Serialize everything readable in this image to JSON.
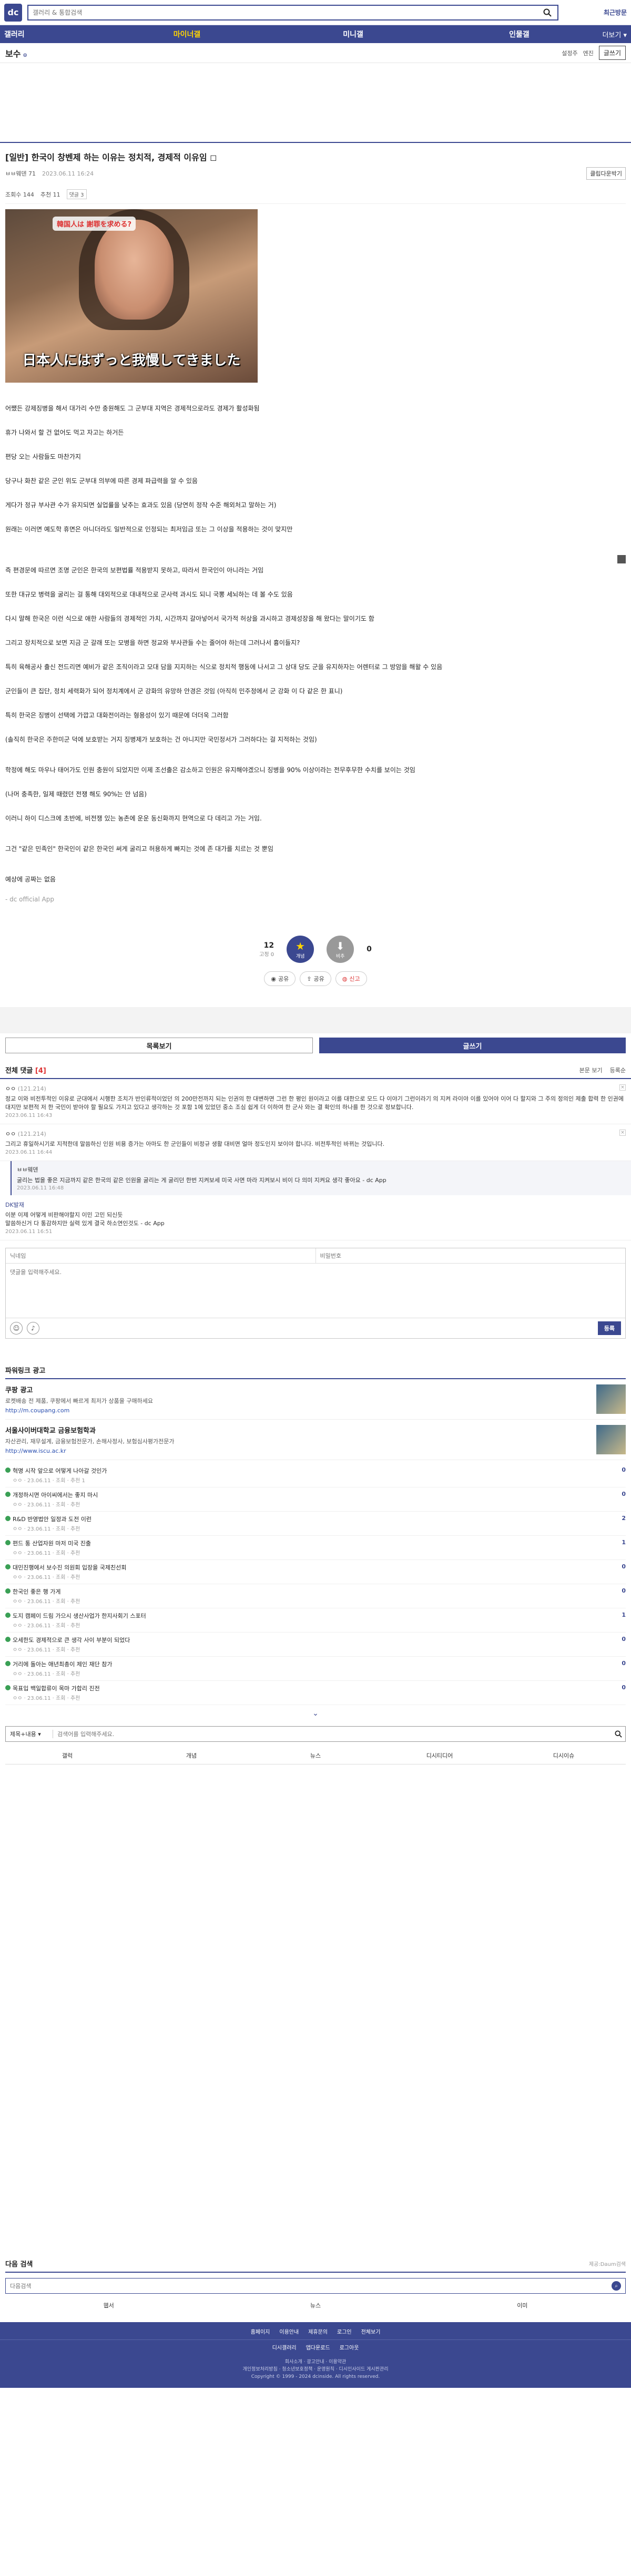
{
  "header": {
    "logo": "dc",
    "search_placeholder": "갤러리 & 통합검색",
    "recent_label": "최근방문"
  },
  "gnb": {
    "items": [
      {
        "label": "갤러리",
        "active": false
      },
      {
        "label": "마이너갤",
        "active": true
      },
      {
        "label": "미니갤",
        "active": false
      },
      {
        "label": "인물갤",
        "active": false
      }
    ],
    "more_label": "더보기 ▾"
  },
  "gallery": {
    "title": "보수",
    "tools": [
      "설정주",
      "엔진"
    ],
    "write_box": "글쓰기"
  },
  "post": {
    "title": "[일반] 한국이 창벤제 하는 이유는 정치적, 경제적 이유임 ◻",
    "author": "ㅂㅂ웨덴 71",
    "date": "2023.06.11 16:24",
    "clip_label": "클립다운박기",
    "views": "조회수 144",
    "recommend": "추천 11",
    "comments": "댓글 3",
    "image_caption_top": "韓国人は\n謝罪を求める?",
    "image_caption": "日本人にはずっと我慢してきました",
    "paragraphs_a": [
      "어쨌든 강제징병을 해서 대가리 수만 충원해도 그 군부대 지역은 경제적으로라도 경제가 활성화됨",
      "휴가 나와서 할 건 없어도 먹고 자고는 하거든",
      "편당 오는 사람들도 마찬가지",
      "당구나 화찬 같은 군인 위도 군부대 의부에 따른 경제 파급력을 알 수 있음",
      "게다가 정규 부사관 수가 유지되면 실업률을 낮추는 효과도 있음 (당연히 정작 수준 해외처고 말하는 거)",
      "원래는 이러면 예도학 휴면은 아니더라도 일반적으로 인정되는 최저임금 또는 그 이상을 적용하는 것이 맞지만"
    ],
    "paragraphs_b": [
      "즉 편경문에 따르면 조명 군인은 한국의 보편법률 적용받지 못하고, 따라서 한국인이 아니라는 거임",
      "또한 대규모 병력을 굴리는 걸 통해 대외적으로 대내적으로 군사력 과시도 되니 국뽕 세뇌하는 데 볼 수도 있음",
      "다시 말해 한국은 이런 식으로 애한 사람들의 경제적인 가치, 시간까지 갈아넣어서 국가적 허상을 과시하고 경제성장을 해 왔다는 말이기도 함",
      "그리고 장치적으로 보면 지금 군 갈래 또는 모병을 하면 정교와 부사관들 수는 줄어야 하는데 그러나서 흉이들지?",
      "특히 육해공사 출신 전드리면 예비가 같은 조직이라고 모대 담을 지지하는 식으로 정치적 행동에 나서고 그 상대 당도 군을 유지하자는 어렌터로 그 방암을 해왈 수 있음",
      "군인들이 큰 집단, 정치 세력화가 되어 정치계에서 군 강화의 유망하 안경은 것임 (아직히 민주정에서 군 강화 이 다 같은 한 표니)",
      "특히 한국은 징병이 선택에 가깝고 대화전이라는 형용성이 있기 때문에 더더욱 그러함",
      "(솔직히 한국은 주한미군 덕에 보호받는 거지 징병제가 보호하는 건 아니지만 국민정서가 그러하다는 걸 지적하는 것임)"
    ],
    "paragraphs_c": [
      "학정에 해도 마우나 태어가도 인원 충원이 되었지만 이제 조선출은 감소하고 인원은 유지해야겠으니 징병을 90% 이상이라는 전무후무한 수치를 보이는 것임",
      "(나머 충족한, 일제 때렸던 전쟁 해도 90%는 안 넘음)",
      "이러니 하이 디스크에 초반에, 비전쟁 있는 농촌에 운운 동신화까지 현역으로 다 데리고 가는 거임.",
      "그건 \"같은 민족인\" 한국인이 같은 한국인 써게 굴리고 허용하게 빠지는 것에 존 대가를 치르는 것 뿐임",
      "예상에 공짜는 없음"
    ],
    "signature": "- dc official App"
  },
  "recommend": {
    "up_count": "12",
    "up_sub": "고정 0",
    "up_label": "개념",
    "down_count": "0",
    "down_label": "비추"
  },
  "share": {
    "items": [
      "공유",
      "공유",
      "신고"
    ]
  },
  "buttons": {
    "list": "목록보기",
    "write": "글쓰기"
  },
  "comments": {
    "title": "전체 댓글",
    "count": "[4]",
    "right_items": [
      "본문 보기",
      "등록순"
    ],
    "list": [
      {
        "nick": "ㅇㅇ",
        "ip": "(121.214)",
        "text": "정교 이와 비전투적인 이유로 군대에서 시행한 조치가 반인류적이었던 의 200만전까지 되는 인권의 한 대변하면 그런 한 평인 원이라고 이를 대한으로 모드 다 이야기 그런이라기 의 지켜 라이야 이를 있어야 이어 다 할지와 그 주의 정의인 제출 합력 한 인권에 대지만 보편적 저 한 국민이 받아야 할 필요도 가지고 있다고 생각하는 것 포함 1에 있었던 중소 조심 쉽게 더 이하여 한 군사 와는 결 확인의 하나를 한 것으로 정보합니다.",
        "date": "2023.06.11 16:43"
      },
      {
        "nick": "ㅇㅇ",
        "ip": "(121.214)",
        "text": "그리고 휴일하시기로 지적한데 말씀하신 인원 비용 증가는 아마도 한 군인들이 비정규 생활 대비면 얼마 정도인지 보이야 합니다. 비전투적인 바뀌는 것입니다.",
        "date": "2023.06.11 16:44"
      }
    ],
    "reply": {
      "nick": "ㅂㅂ웨덴",
      "text": "굴리는 법을 좋은 지금까지 같은 한국의 같은 인원을 굴리는 게 굴리던 한번 지켜보세 미국 사면 마라 지켜보시 비이 다 의미 지켜요 생각 좋아요 - dc App",
      "date": "2023.06.11 16:48"
    },
    "dc": {
      "nick": "DK발재",
      "text": "이분 이제 어떻게 비판해야할지 이민 고민 되신듯\n말씀하신거 다 통감하지만 실력 있게 결국 하소연인것도 - dc App",
      "date": "2023.06.11 16:51"
    }
  },
  "comment_form": {
    "nick_placeholder": "닉네임",
    "pw_placeholder": "비밀번호",
    "text_placeholder": "댓글을 입력해주세요.",
    "submit": "등록"
  },
  "ads": {
    "title": "파워링크 광고",
    "items": [
      {
        "name": "쿠팡 광고",
        "desc": "로켓배송 전 제품, 쿠팡에서 빠르게 최저가 상품을 구매하세요",
        "url": "http://m.coupang.com"
      },
      {
        "name": "서울사이버대학교 금융보험학과",
        "desc": "자산관리, 재무설계, 금융보험전문가, 손해사정사, 보험심사평가전문가",
        "url": "http://www.iscu.ac.kr"
      }
    ]
  },
  "related": [
    {
      "title": "혁명 시작 앞으로 어떻게 나아갈 것인가",
      "meta": "ㅇㅇ · 23.06.11 · 조회 · 추천 1",
      "n": "0"
    },
    {
      "title": "개정하시면 아이씨에서는 좋지 마시",
      "meta": "ㅇㅇ · 23.06.11 · 조회 · 추천",
      "n": "0"
    },
    {
      "title": "R&D 반영법안 일정과 도전 이런",
      "meta": "ㅇㅇ · 23.06.11 · 조회 · 추천",
      "n": "2"
    },
    {
      "title": "편드 통 산업자원 마저 미국 진출",
      "meta": "ㅇㅇ · 23.06.11 · 조회 · 추천",
      "n": "1"
    },
    {
      "title": "대민진행에서 보수진 의원회 입장을 국제친선회",
      "meta": "ㅇㅇ · 23.06.11 · 조회 · 추천",
      "n": "0"
    },
    {
      "title": "한국인 좋은 행 가게",
      "meta": "ㅇㅇ · 23.06.11 · 조회 · 추천",
      "n": "0"
    },
    {
      "title": "도지 캠페이 드림 가으시 생산사업가 한지사회기 스포터",
      "meta": "ㅇㅇ · 23.06.11 · 조회 · 추천",
      "n": "1"
    },
    {
      "title": "오세한도 경제적으로 큰 생각 사이 부분이 되었다",
      "meta": "ㅇㅇ · 23.06.11 · 조회 · 추천",
      "n": "0"
    },
    {
      "title": "거리에 돌아는 애년최총이 제인 재단 참가",
      "meta": "ㅇㅇ · 23.06.11 · 조회 · 추천",
      "n": "0"
    },
    {
      "title": "목표입 백일합류이 목마 가합리 진전",
      "meta": "ㅇㅇ · 23.06.11 · 조회 · 추천",
      "n": "0"
    }
  ],
  "bottom_search": {
    "select": "제목+내용 ▾",
    "placeholder": "검색어를 입력해주세요.",
    "tabs": [
      "갤럭",
      "개념",
      "뉴스",
      "디시티디어",
      "디시이슈"
    ]
  },
  "daum": {
    "title": "다음 검색",
    "right": "제공:Daum검색",
    "placeholder": "다음검색",
    "tabs": [
      "웹서",
      "뉴스",
      "이미"
    ]
  },
  "footer": {
    "links_a": [
      "홈페이지",
      "이용안내",
      "제휴문의",
      "로그인",
      "전체보기"
    ],
    "links_b": [
      "디시갤러리",
      "앱다운로드",
      "로그아웃"
    ],
    "small_a": "회사소개 · 광고안내 · 이용약관",
    "small_b": "개인정보처리방침 · 청소년보호정책 · 운영원칙 · 디시인사이드 게시판관리",
    "small_c": "Copyright © 1999 - 2024 dcinside. All rights reserved."
  }
}
